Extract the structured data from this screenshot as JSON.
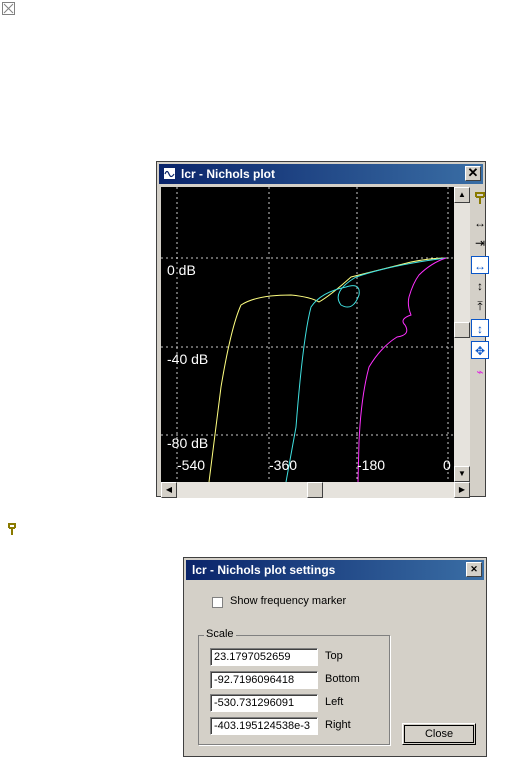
{
  "desktop": {
    "top_icon": "broken-image-icon",
    "mid_icon": "tuning-fork-icon"
  },
  "nichols_window": {
    "title": "lcr - Nichols plot",
    "close_glyph": "✕",
    "y_labels": [
      "0 dB",
      "-40 dB",
      "-80 dB"
    ],
    "x_labels": [
      "-540",
      "-360",
      "-180",
      "0"
    ],
    "toolbar_icons": [
      "tuning-fork-icon",
      "expand-horizontal-icon",
      "compress-horizontal-icon",
      "fit-horizontal-icon",
      "expand-vertical-icon",
      "compress-vertical-icon",
      "fit-vertical-icon",
      "fit-all-icon",
      "marker-icon"
    ],
    "colors": {
      "background": "#000000",
      "grid": "#c8c8c8",
      "trace_yellow": "#ffff80",
      "trace_cyan": "#40e0e0",
      "trace_magenta": "#ff30ff"
    }
  },
  "settings_dialog": {
    "title": "lcr - Nichols plot settings",
    "close_glyph": "✕",
    "show_marker_label": "Show frequency marker",
    "show_marker_checked": false,
    "scale_group_label": "Scale",
    "fields": [
      {
        "value": "23.1797052659",
        "label": "Top"
      },
      {
        "value": "-92.7196096418",
        "label": "Bottom"
      },
      {
        "value": "-530.731296091",
        "label": "Left"
      },
      {
        "value": "-403.195124538e-3",
        "label": "Right"
      }
    ],
    "close_button_label": "Close"
  }
}
